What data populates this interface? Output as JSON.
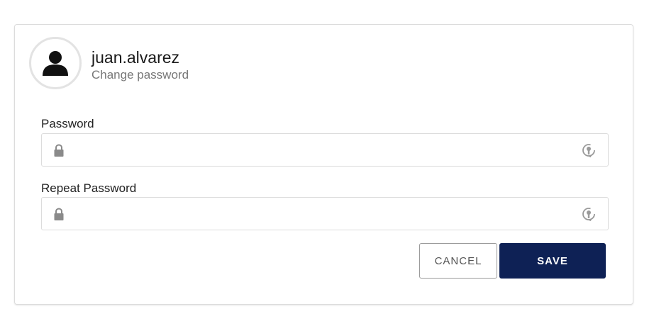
{
  "profile": {
    "username": "juan.alvarez",
    "subtitle": "Change password",
    "avatar_icon": "user-icon"
  },
  "fields": [
    {
      "label": "Password",
      "value": "",
      "placeholder": "",
      "leading_icon": "lock-icon",
      "trailing_icon": "reveal-password-icon"
    },
    {
      "label": "Repeat Password",
      "value": "",
      "placeholder": "",
      "leading_icon": "lock-icon",
      "trailing_icon": "reveal-password-icon"
    }
  ],
  "actions": {
    "cancel_label": "CANCEL",
    "save_label": "SAVE"
  },
  "colors": {
    "primary": "#0e2155",
    "border": "#dcdcdc",
    "icon": "#8a8a8a",
    "subtitle": "#777777"
  }
}
